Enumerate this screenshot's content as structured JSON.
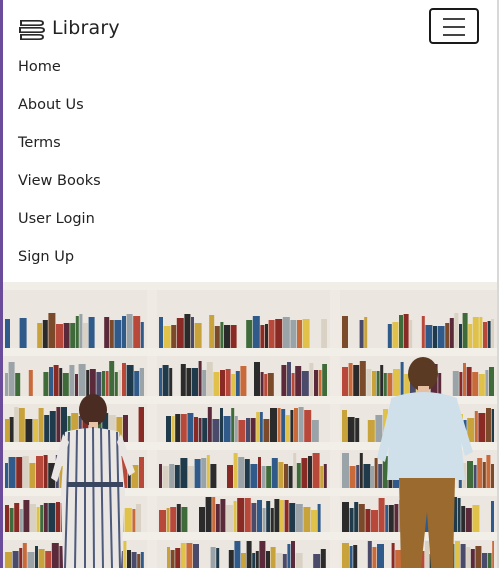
{
  "navbar": {
    "brand": {
      "icon": "books-stack-icon",
      "label": "Library"
    },
    "toggler": {
      "icon": "hamburger-menu-icon"
    },
    "links": [
      {
        "label": "Home"
      },
      {
        "label": "About Us"
      },
      {
        "label": "Terms"
      },
      {
        "label": "View Books"
      },
      {
        "label": "User Login"
      },
      {
        "label": "Sign Up"
      }
    ]
  },
  "hero": {
    "image": "library-bookshelves-photo"
  },
  "colors": {
    "frame_accent": "#6b4c9a",
    "text": "#222222",
    "shelf_wood": "#e9e4dc"
  }
}
